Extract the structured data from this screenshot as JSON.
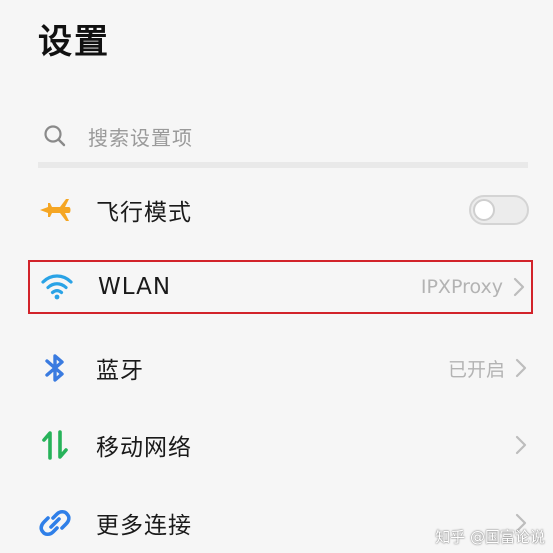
{
  "header": {
    "title": "设置"
  },
  "search": {
    "icon": "search-icon",
    "placeholder": "搜索设置项"
  },
  "settings": {
    "items": [
      {
        "label": "飞行模式",
        "icon": "airplane-icon",
        "icon_color": "#f5a623",
        "toggle_on": false
      },
      {
        "label": "WLAN",
        "icon": "wifi-icon",
        "icon_color": "#2aa3e6",
        "value": "IPXProxy",
        "highlighted": true
      },
      {
        "label": "蓝牙",
        "icon": "bluetooth-icon",
        "icon_color": "#3a7be0",
        "value": "已开启"
      },
      {
        "label": "移动网络",
        "icon": "mobile-network-icon",
        "icon_color": "#27b35a",
        "value": ""
      },
      {
        "label": "更多连接",
        "icon": "link-icon",
        "icon_color": "#2f7fe8",
        "value": ""
      }
    ]
  },
  "watermark": {
    "text": "知乎 @国富论说"
  },
  "colors": {
    "background": "#f6f6f6",
    "highlight_border": "#d2232a",
    "secondary_text": "#b3b3b3"
  }
}
